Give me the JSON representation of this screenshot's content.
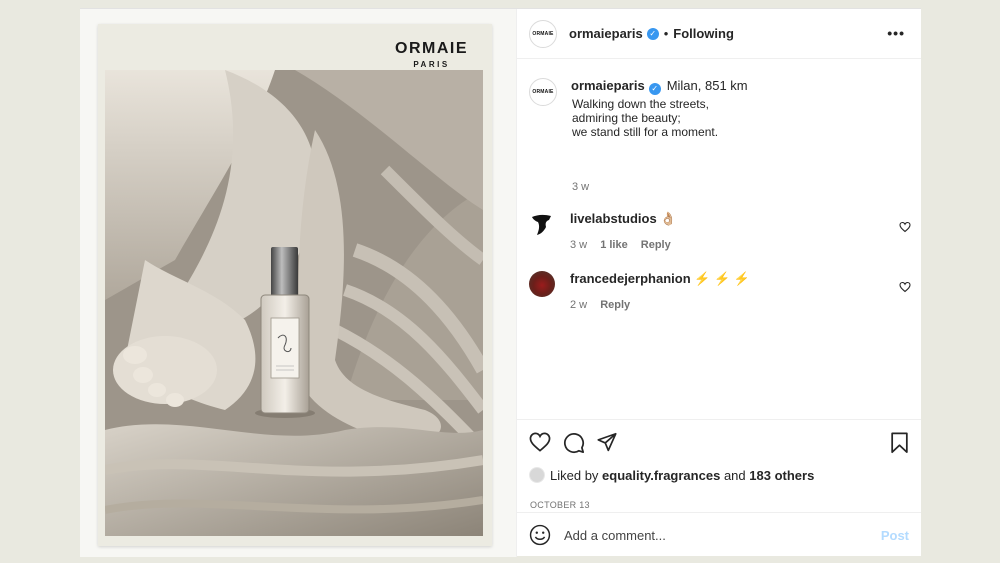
{
  "brand": {
    "name": "ORMAIE",
    "sub": "PARIS",
    "avatar_text": "ORMAIE"
  },
  "header": {
    "username": "ormaieparis",
    "separator": "•",
    "follow_label": "Following",
    "more": "•••"
  },
  "caption": {
    "username": "ormaieparis",
    "location": "Milan,  851 km",
    "text": "Walking down the streets,\nadmiring the beauty;\nwe stand still for a moment.",
    "time": "3 w"
  },
  "comments": [
    {
      "username": "livelabstudios",
      "emoji": "👌🏼",
      "time": "3 w",
      "likes": "1 like",
      "reply": "Reply"
    },
    {
      "username": "francedejerphanion",
      "emoji": "⚡ ⚡ ⚡",
      "time": "2 w",
      "likes": "",
      "reply": "Reply"
    }
  ],
  "likes": {
    "prefix": "Liked by",
    "user": "equality.fragrances",
    "middle": "and",
    "others": "183 others"
  },
  "date": "OCTOBER 13",
  "add_comment": {
    "placeholder": "Add a comment...",
    "post_label": "Post"
  },
  "colors": {
    "verified": "#3897f0",
    "post_disabled": "#b3dbff"
  }
}
